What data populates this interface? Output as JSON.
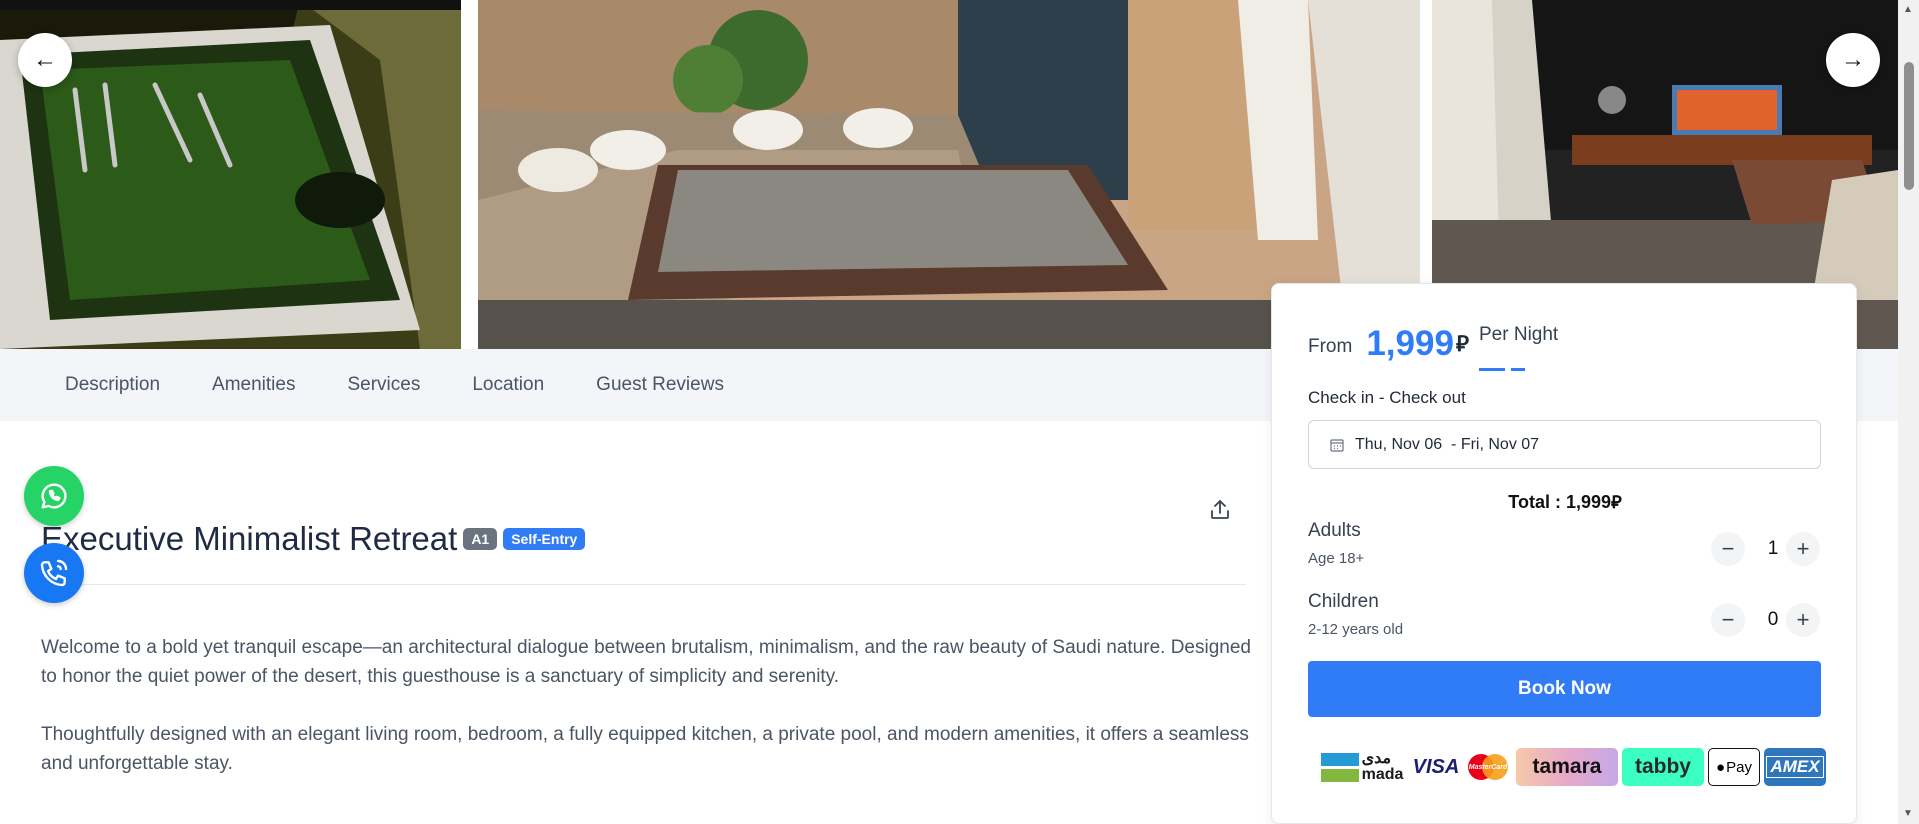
{
  "gallery": {
    "prev_label": "←",
    "next_label": "→"
  },
  "tabs": [
    "Description",
    "Amenities",
    "Services",
    "Location",
    "Guest Reviews"
  ],
  "listing": {
    "title": "Executive Minimalist Retreat",
    "badge_unit": "A1",
    "badge_entry": "Self-Entry",
    "paragraph_1": "Welcome to a bold yet tranquil escape—an architectural dialogue between brutalism, minimalism, and the raw beauty of Saudi nature. Designed to honor the quiet power of the desert, this guesthouse is a sanctuary of simplicity and serenity.",
    "paragraph_2": "Thoughtfully designed with an elegant living room, bedroom, a fully equipped kitchen, a private pool, and modern amenities, it offers a seamless and unforgettable stay."
  },
  "booking": {
    "from_label": "From",
    "price": "1,999",
    "currency_symbol": "⃁",
    "per_night": "Per Night",
    "check_label": "Check in - Check out",
    "date_range": "Thu, Nov 06  - Fri, Nov 07",
    "total": "Total : 1,999⃁",
    "adults_label": "Adults",
    "adults_sub": "Age 18+",
    "adults_value": "1",
    "children_label": "Children",
    "children_sub": "2-12 years old",
    "children_value": "0",
    "minus": "−",
    "plus": "+",
    "book_label": "Book Now"
  },
  "payments": {
    "mada_ar": "مدى",
    "mada": "mada",
    "visa": "VISA",
    "mastercard": "MasterCard",
    "tamara": "tamara",
    "tabby": "tabby",
    "applepay": "Pay",
    "amex": "AMEX"
  },
  "colors": {
    "accent": "#2f7cf6",
    "whatsapp": "#25d366",
    "call": "#1877f2",
    "badge_gray": "#6b7280"
  }
}
